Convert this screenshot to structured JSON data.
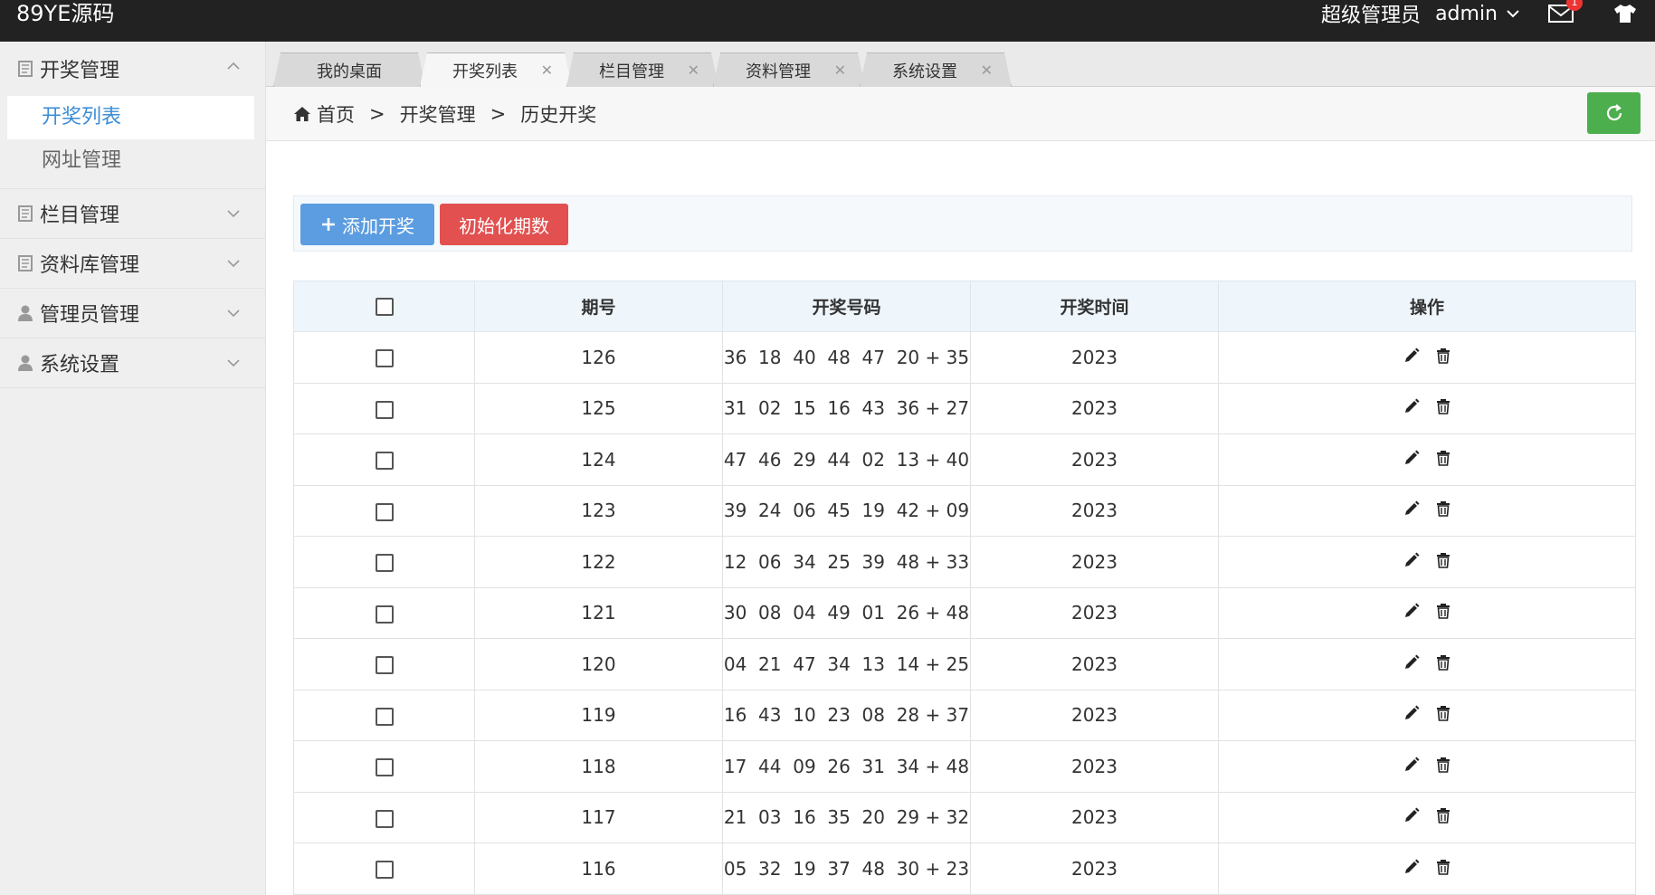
{
  "app": {
    "brand": "89YE源码",
    "role": "超级管理员",
    "user": "admin",
    "mail_badge": "1"
  },
  "sidebar": {
    "groups": [
      {
        "label": "开奖管理",
        "icon": "document-icon",
        "open": true,
        "children": [
          {
            "label": "开奖列表",
            "active": true
          },
          {
            "label": "网址管理",
            "active": false
          }
        ]
      },
      {
        "label": "栏目管理",
        "icon": "document-icon"
      },
      {
        "label": "资料库管理",
        "icon": "document-icon"
      },
      {
        "label": "管理员管理",
        "icon": "user-icon"
      },
      {
        "label": "系统设置",
        "icon": "user-icon"
      }
    ]
  },
  "tabs": [
    {
      "label": "我的桌面",
      "closable": false,
      "active": false
    },
    {
      "label": "开奖列表",
      "closable": true,
      "active": true
    },
    {
      "label": "栏目管理",
      "closable": true,
      "active": false
    },
    {
      "label": "资料管理",
      "closable": true,
      "active": false
    },
    {
      "label": "系统设置",
      "closable": true,
      "active": false
    }
  ],
  "breadcrumb": {
    "home": "首页",
    "sep": ">",
    "level1": "开奖管理",
    "level2": "历史开奖"
  },
  "toolbar": {
    "add_label": "添加开奖",
    "init_label": "初始化期数"
  },
  "table": {
    "headers": {
      "issue": "期号",
      "numbers": "开奖号码",
      "time": "开奖时间",
      "actions": "操作"
    },
    "rows": [
      {
        "issue": "126",
        "numbers": "36  18  40  48  47  20 + 35",
        "time": "2023"
      },
      {
        "issue": "125",
        "numbers": "31  02  15  16  43  36 + 27",
        "time": "2023"
      },
      {
        "issue": "124",
        "numbers": "47  46  29  44  02  13 + 40",
        "time": "2023"
      },
      {
        "issue": "123",
        "numbers": "39  24  06  45  19  42 + 09",
        "time": "2023"
      },
      {
        "issue": "122",
        "numbers": "12  06  34  25  39  48 + 33",
        "time": "2023"
      },
      {
        "issue": "121",
        "numbers": "30  08  04  49  01  26 + 48",
        "time": "2023"
      },
      {
        "issue": "120",
        "numbers": "04  21  47  34  13  14 + 25",
        "time": "2023"
      },
      {
        "issue": "119",
        "numbers": "16  43  10  23  08  28 + 37",
        "time": "2023"
      },
      {
        "issue": "118",
        "numbers": "17  44  09  26  31  34 + 48",
        "time": "2023"
      },
      {
        "issue": "117",
        "numbers": "21  03  16  35  20  29 + 32",
        "time": "2023"
      },
      {
        "issue": "116",
        "numbers": "05  32  19  37  48  30 + 23",
        "time": "2023"
      }
    ]
  },
  "colors": {
    "topbar": "#222222",
    "accent": "#3c8dd6",
    "add_btn": "#5b9de0",
    "init_btn": "#e25050",
    "refresh_btn": "#4cae4c"
  }
}
